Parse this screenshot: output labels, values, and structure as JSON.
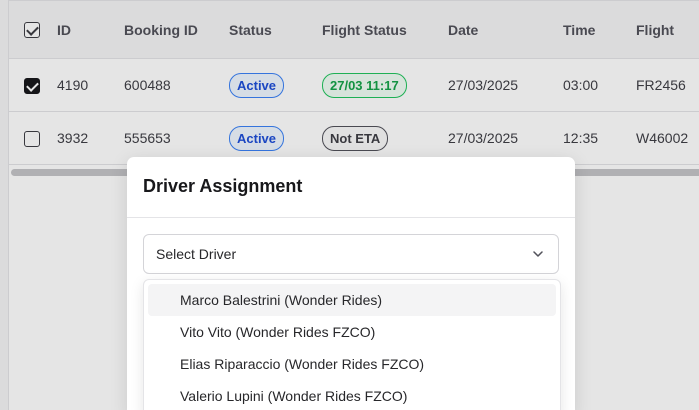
{
  "table": {
    "columns": [
      "ID",
      "Booking ID",
      "Status",
      "Flight Status",
      "Date",
      "Time",
      "Flight"
    ],
    "rows": [
      {
        "checked": true,
        "id": "4190",
        "booking_id": "600488",
        "status": "Active",
        "flight_status": "27/03 11:17",
        "date": "27/03/2025",
        "time": "03:00",
        "flight": "FR2456"
      },
      {
        "checked": false,
        "id": "3932",
        "booking_id": "555653",
        "status": "Active",
        "flight_status": "Not ETA",
        "date": "27/03/2025",
        "time": "12:35",
        "flight": "W46002"
      }
    ]
  },
  "modal": {
    "title": "Driver Assignment",
    "select_placeholder": "Select Driver",
    "options": [
      "Marco Balestrini (Wonder Rides)",
      "Vito Vito (Wonder Rides FZCO)",
      "Elias Riparaccio (Wonder Rides FZCO)",
      "Valerio Lupini (Wonder Rides FZCO)"
    ],
    "highlighted_option": 0
  },
  "colors": {
    "active_badge": "#3b82f6",
    "flight_badge": "#22c55e",
    "overlay": "rgba(0,0,0,0.10)"
  }
}
